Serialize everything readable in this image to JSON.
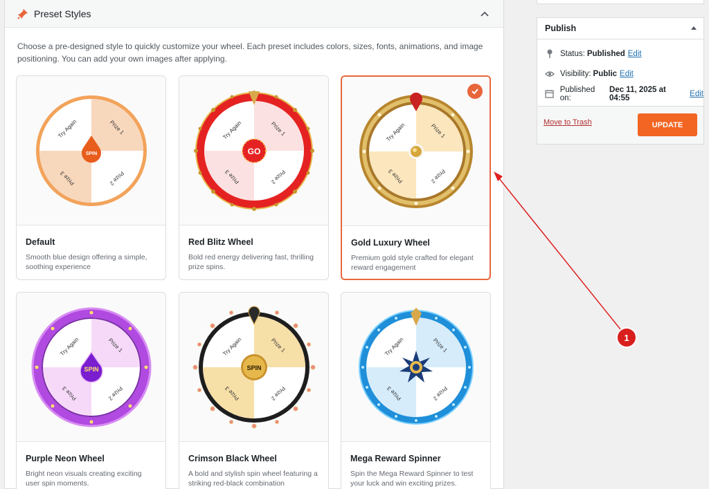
{
  "panel": {
    "title": "Preset Styles",
    "description": "Choose a pre-designed style to quickly customize your wheel. Each preset includes colors, sizes, fonts, animations, and image positioning. You can add your own images after applying."
  },
  "presets": [
    {
      "name": "Default",
      "description": "Smooth blue design offering a simple, soothing experience",
      "center": "SPIN",
      "prizes": [
        "Try Again",
        "Prize 1",
        "Prize 2",
        "Prize 3"
      ]
    },
    {
      "name": "Red Blitz Wheel",
      "description": "Bold red energy delivering fast, thrilling prize spins.",
      "center": "GO",
      "prizes": [
        "Try Again",
        "Prize 1",
        "Prize 2",
        "Prize 3"
      ]
    },
    {
      "name": "Gold Luxury Wheel",
      "description": "Premium gold style crafted for elegant reward engagement",
      "selected": true,
      "prizes": [
        "Try Again",
        "Prize 1",
        "Prize 2",
        "Prize 3"
      ]
    },
    {
      "name": "Purple Neon Wheel",
      "description": "Bright neon visuals creating exciting user spin moments.",
      "center": "SPIN",
      "prizes": [
        "Try Again",
        "Prize 1",
        "Prize 2",
        "Prize 3"
      ]
    },
    {
      "name": "Crimson Black Wheel",
      "description": "A bold and stylish spin wheel featuring a striking red-black combination",
      "center": "SPIN",
      "prizes": [
        "Try Again",
        "Prize 1",
        "Prize 2",
        "Prize 3"
      ]
    },
    {
      "name": "Mega Reward Spinner",
      "description": "Spin the Mega Reward Spinner to test your luck and win exciting prizes.",
      "prizes": [
        "Try Again",
        "Prize 1",
        "Prize 2",
        "Prize 3"
      ]
    }
  ],
  "publish": {
    "title": "Publish",
    "status_label": "Status:",
    "status_value": "Published",
    "visibility_label": "Visibility:",
    "visibility_value": "Public",
    "published_label": "Published on:",
    "published_value": "Dec 11, 2025 at 04:55",
    "edit": "Edit",
    "trash": "Move to Trash",
    "update": "UPDATE"
  },
  "annotation": {
    "number": "1"
  },
  "colors": {
    "accent": "#f26522",
    "selected_border": "#e8663b",
    "link": "#2271b1"
  }
}
